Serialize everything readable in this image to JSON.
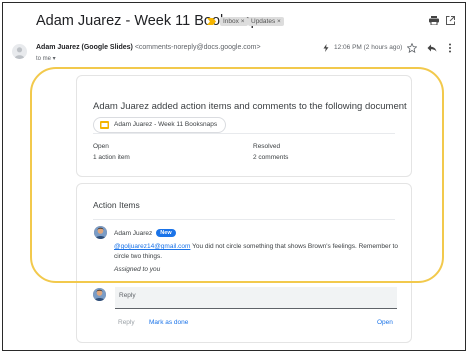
{
  "email": {
    "subject": "Adam Juarez - Week 11 Booksnaps",
    "labels": [
      "Inbox ×",
      "Updates ×"
    ],
    "sender_name": "Adam Juarez (Google Slides)",
    "sender_email": "<comments-noreply@docs.google.com>",
    "to_me": "to me ▾",
    "time": "12:06 PM (2 hours ago)"
  },
  "notification": {
    "title": "Adam Juarez added action items and comments to the following document",
    "doc_name": "Adam Juarez - Week 11 Booksnaps",
    "open_label": "Open",
    "open_count": "1 action item",
    "resolved_label": "Resolved",
    "resolved_count": "2 comments"
  },
  "action_items": {
    "title": "Action Items",
    "commenter": "Adam Juarez",
    "badge": "New",
    "mention": "@goljuarez14@gmail.com",
    "comment_text": " You did not circle something that shows Brown's feelings. Remember to circle two things.",
    "assigned": "Assigned to you",
    "reply_placeholder": "Reply",
    "reply_button": "Reply",
    "mark_done_button": "Mark as done",
    "open_button": "Open"
  },
  "colors": {
    "highlight": "#f2c94c",
    "link": "#1a73e8",
    "badge": "#1a73e8",
    "important": "#f4b400"
  },
  "icons": [
    "important-marker-icon",
    "print-icon",
    "open-in-new-icon",
    "person-icon",
    "lightning-icon",
    "star-icon",
    "reply-icon",
    "more-vert-icon",
    "slides-doc-icon"
  ]
}
